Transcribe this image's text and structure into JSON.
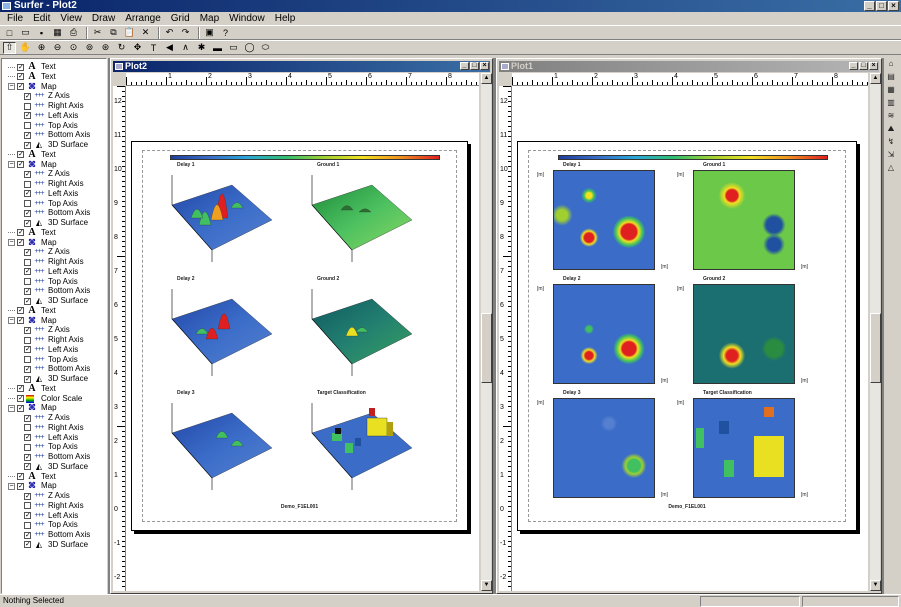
{
  "window": {
    "title": "Surfer - Plot2",
    "buttons": [
      "_",
      "□",
      "×"
    ]
  },
  "menu": [
    "File",
    "Edit",
    "View",
    "Draw",
    "Arrange",
    "Grid",
    "Map",
    "Window",
    "Help"
  ],
  "toolbar1_icons": [
    "new-icon",
    "open-icon",
    "save-icon",
    "print-preview-icon",
    "print-icon",
    "cut-icon",
    "copy-icon",
    "paste-icon",
    "delete-icon",
    "undo-icon",
    "redo-icon",
    "select-tool-icon",
    "help-icon"
  ],
  "toolbar1_glyphs": [
    "□",
    "▭",
    "▪",
    "▦",
    "⎙",
    "✂",
    "⧉",
    "📋",
    "✕",
    "↶",
    "↷",
    "▣",
    "?"
  ],
  "toolbar2_glyphs": [
    "⇧",
    "✋",
    "⊕",
    "⊖",
    "⊙",
    "⊚",
    "⊛",
    "↻",
    "✥",
    "T",
    "◀",
    "∧",
    "✱",
    "▬",
    "▭",
    "◯",
    "⬭"
  ],
  "object_manager": [
    {
      "level": 0,
      "type": "text",
      "label": "Text"
    },
    {
      "level": 0,
      "type": "text",
      "label": "Text"
    },
    {
      "level": 0,
      "type": "map",
      "label": "Map",
      "expanded": true
    },
    {
      "level": 1,
      "type": "axis",
      "label": "Z Axis",
      "checked": true
    },
    {
      "level": 1,
      "type": "axis",
      "label": "Right Axis",
      "checked": false
    },
    {
      "level": 1,
      "type": "axis",
      "label": "Left Axis",
      "checked": true
    },
    {
      "level": 1,
      "type": "axis",
      "label": "Top Axis",
      "checked": false
    },
    {
      "level": 1,
      "type": "axis",
      "label": "Bottom Axis",
      "checked": true
    },
    {
      "level": 1,
      "type": "surf",
      "label": "3D Surface",
      "checked": true
    },
    {
      "level": 0,
      "type": "text",
      "label": "Text"
    },
    {
      "level": 0,
      "type": "map",
      "label": "Map",
      "expanded": true
    },
    {
      "level": 1,
      "type": "axis",
      "label": "Z Axis",
      "checked": true
    },
    {
      "level": 1,
      "type": "axis",
      "label": "Right Axis",
      "checked": false
    },
    {
      "level": 1,
      "type": "axis",
      "label": "Left Axis",
      "checked": true
    },
    {
      "level": 1,
      "type": "axis",
      "label": "Top Axis",
      "checked": false
    },
    {
      "level": 1,
      "type": "axis",
      "label": "Bottom Axis",
      "checked": true
    },
    {
      "level": 1,
      "type": "surf",
      "label": "3D Surface",
      "checked": true
    },
    {
      "level": 0,
      "type": "text",
      "label": "Text"
    },
    {
      "level": 0,
      "type": "map",
      "label": "Map",
      "expanded": true
    },
    {
      "level": 1,
      "type": "axis",
      "label": "Z Axis",
      "checked": true
    },
    {
      "level": 1,
      "type": "axis",
      "label": "Right Axis",
      "checked": false
    },
    {
      "level": 1,
      "type": "axis",
      "label": "Left Axis",
      "checked": true
    },
    {
      "level": 1,
      "type": "axis",
      "label": "Top Axis",
      "checked": false
    },
    {
      "level": 1,
      "type": "axis",
      "label": "Bottom Axis",
      "checked": true
    },
    {
      "level": 1,
      "type": "surf",
      "label": "3D Surface",
      "checked": true
    },
    {
      "level": 0,
      "type": "text",
      "label": "Text"
    },
    {
      "level": 0,
      "type": "map",
      "label": "Map",
      "expanded": true
    },
    {
      "level": 1,
      "type": "axis",
      "label": "Z Axis",
      "checked": true
    },
    {
      "level": 1,
      "type": "axis",
      "label": "Right Axis",
      "checked": false
    },
    {
      "level": 1,
      "type": "axis",
      "label": "Left Axis",
      "checked": true
    },
    {
      "level": 1,
      "type": "axis",
      "label": "Top Axis",
      "checked": false
    },
    {
      "level": 1,
      "type": "axis",
      "label": "Bottom Axis",
      "checked": true
    },
    {
      "level": 1,
      "type": "surf",
      "label": "3D Surface",
      "checked": true
    },
    {
      "level": 0,
      "type": "text",
      "label": "Text"
    },
    {
      "level": 0,
      "type": "scale",
      "label": "Color Scale"
    },
    {
      "level": 0,
      "type": "map",
      "label": "Map",
      "expanded": true
    },
    {
      "level": 1,
      "type": "axis",
      "label": "Z Axis",
      "checked": true
    },
    {
      "level": 1,
      "type": "axis",
      "label": "Right Axis",
      "checked": false
    },
    {
      "level": 1,
      "type": "axis",
      "label": "Left Axis",
      "checked": true
    },
    {
      "level": 1,
      "type": "axis",
      "label": "Top Axis",
      "checked": false
    },
    {
      "level": 1,
      "type": "axis",
      "label": "Bottom Axis",
      "checked": true
    },
    {
      "level": 1,
      "type": "surf",
      "label": "3D Surface",
      "checked": true
    },
    {
      "level": 0,
      "type": "text",
      "label": "Text"
    },
    {
      "level": 0,
      "type": "map",
      "label": "Map",
      "expanded": true
    },
    {
      "level": 1,
      "type": "axis",
      "label": "Z Axis",
      "checked": true
    },
    {
      "level": 1,
      "type": "axis",
      "label": "Right Axis",
      "checked": false
    },
    {
      "level": 1,
      "type": "axis",
      "label": "Left Axis",
      "checked": true
    },
    {
      "level": 1,
      "type": "axis",
      "label": "Top Axis",
      "checked": false
    },
    {
      "level": 1,
      "type": "axis",
      "label": "Bottom Axis",
      "checked": true
    },
    {
      "level": 1,
      "type": "surf",
      "label": "3D Surface",
      "checked": true
    }
  ],
  "plot2": {
    "title": "Plot2",
    "panels": [
      "Delay 1",
      "Ground 1",
      "Delay 2",
      "Ground 2",
      "Delay 3",
      "Target Classification"
    ],
    "footer": "Demo_F1EL001"
  },
  "plot1": {
    "title": "Plot1",
    "panels": [
      "Delay 1",
      "Ground 1",
      "Delay 2",
      "Ground 2",
      "Delay 3",
      "Target Classification"
    ],
    "footer": "Demo_F1EL001",
    "axis_unit": "[m]"
  },
  "ruler_v_labels": [
    "12",
    "11",
    "10",
    "9",
    "8",
    "7",
    "6",
    "5",
    "4",
    "3",
    "2",
    "1",
    "0",
    "-1",
    "-2"
  ],
  "ruler_h_labels": [
    "1",
    "2",
    "3",
    "4",
    "5",
    "6",
    "7",
    "8",
    "9"
  ],
  "side_tool_glyphs": [
    "⌂",
    "▤",
    "▦",
    "▥",
    "≋",
    "⛰",
    "↯",
    "⇲",
    "△"
  ],
  "status": "Nothing Selected",
  "colors": {
    "title_active": "#0a246a",
    "face": "#d4d0c8",
    "mdi_bg": "#808080"
  }
}
